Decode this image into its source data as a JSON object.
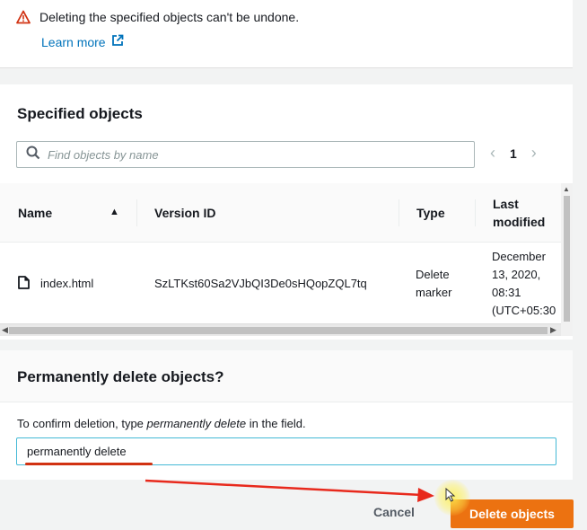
{
  "warning": {
    "message": "Deleting the specified objects can't be undone.",
    "learn_more": "Learn more",
    "icon": "warning-triangle-icon",
    "color": "#d13212"
  },
  "objects": {
    "title": "Specified objects",
    "search_placeholder": "Find objects by name",
    "page_number": "1",
    "columns": [
      "Name",
      "Version ID",
      "Type",
      "Last modified"
    ],
    "rows": [
      {
        "name": "index.html",
        "version_id": "SzLTKst60Sa2VJbQI3De0sHQopZQL7tq",
        "type_line1": "Delete",
        "type_line2": "marker",
        "modified_lines": [
          "December",
          "13, 2020,",
          "08:31",
          "(UTC+05:30"
        ]
      }
    ]
  },
  "permanent": {
    "title": "Permanently delete objects?",
    "confirm_prefix": "To confirm deletion, type ",
    "confirm_keyword": "permanently delete",
    "confirm_suffix": " in the field.",
    "input_value": "permanently delete"
  },
  "footer": {
    "cancel_label": "Cancel",
    "delete_label": "Delete objects",
    "accent": "#ec7211"
  }
}
